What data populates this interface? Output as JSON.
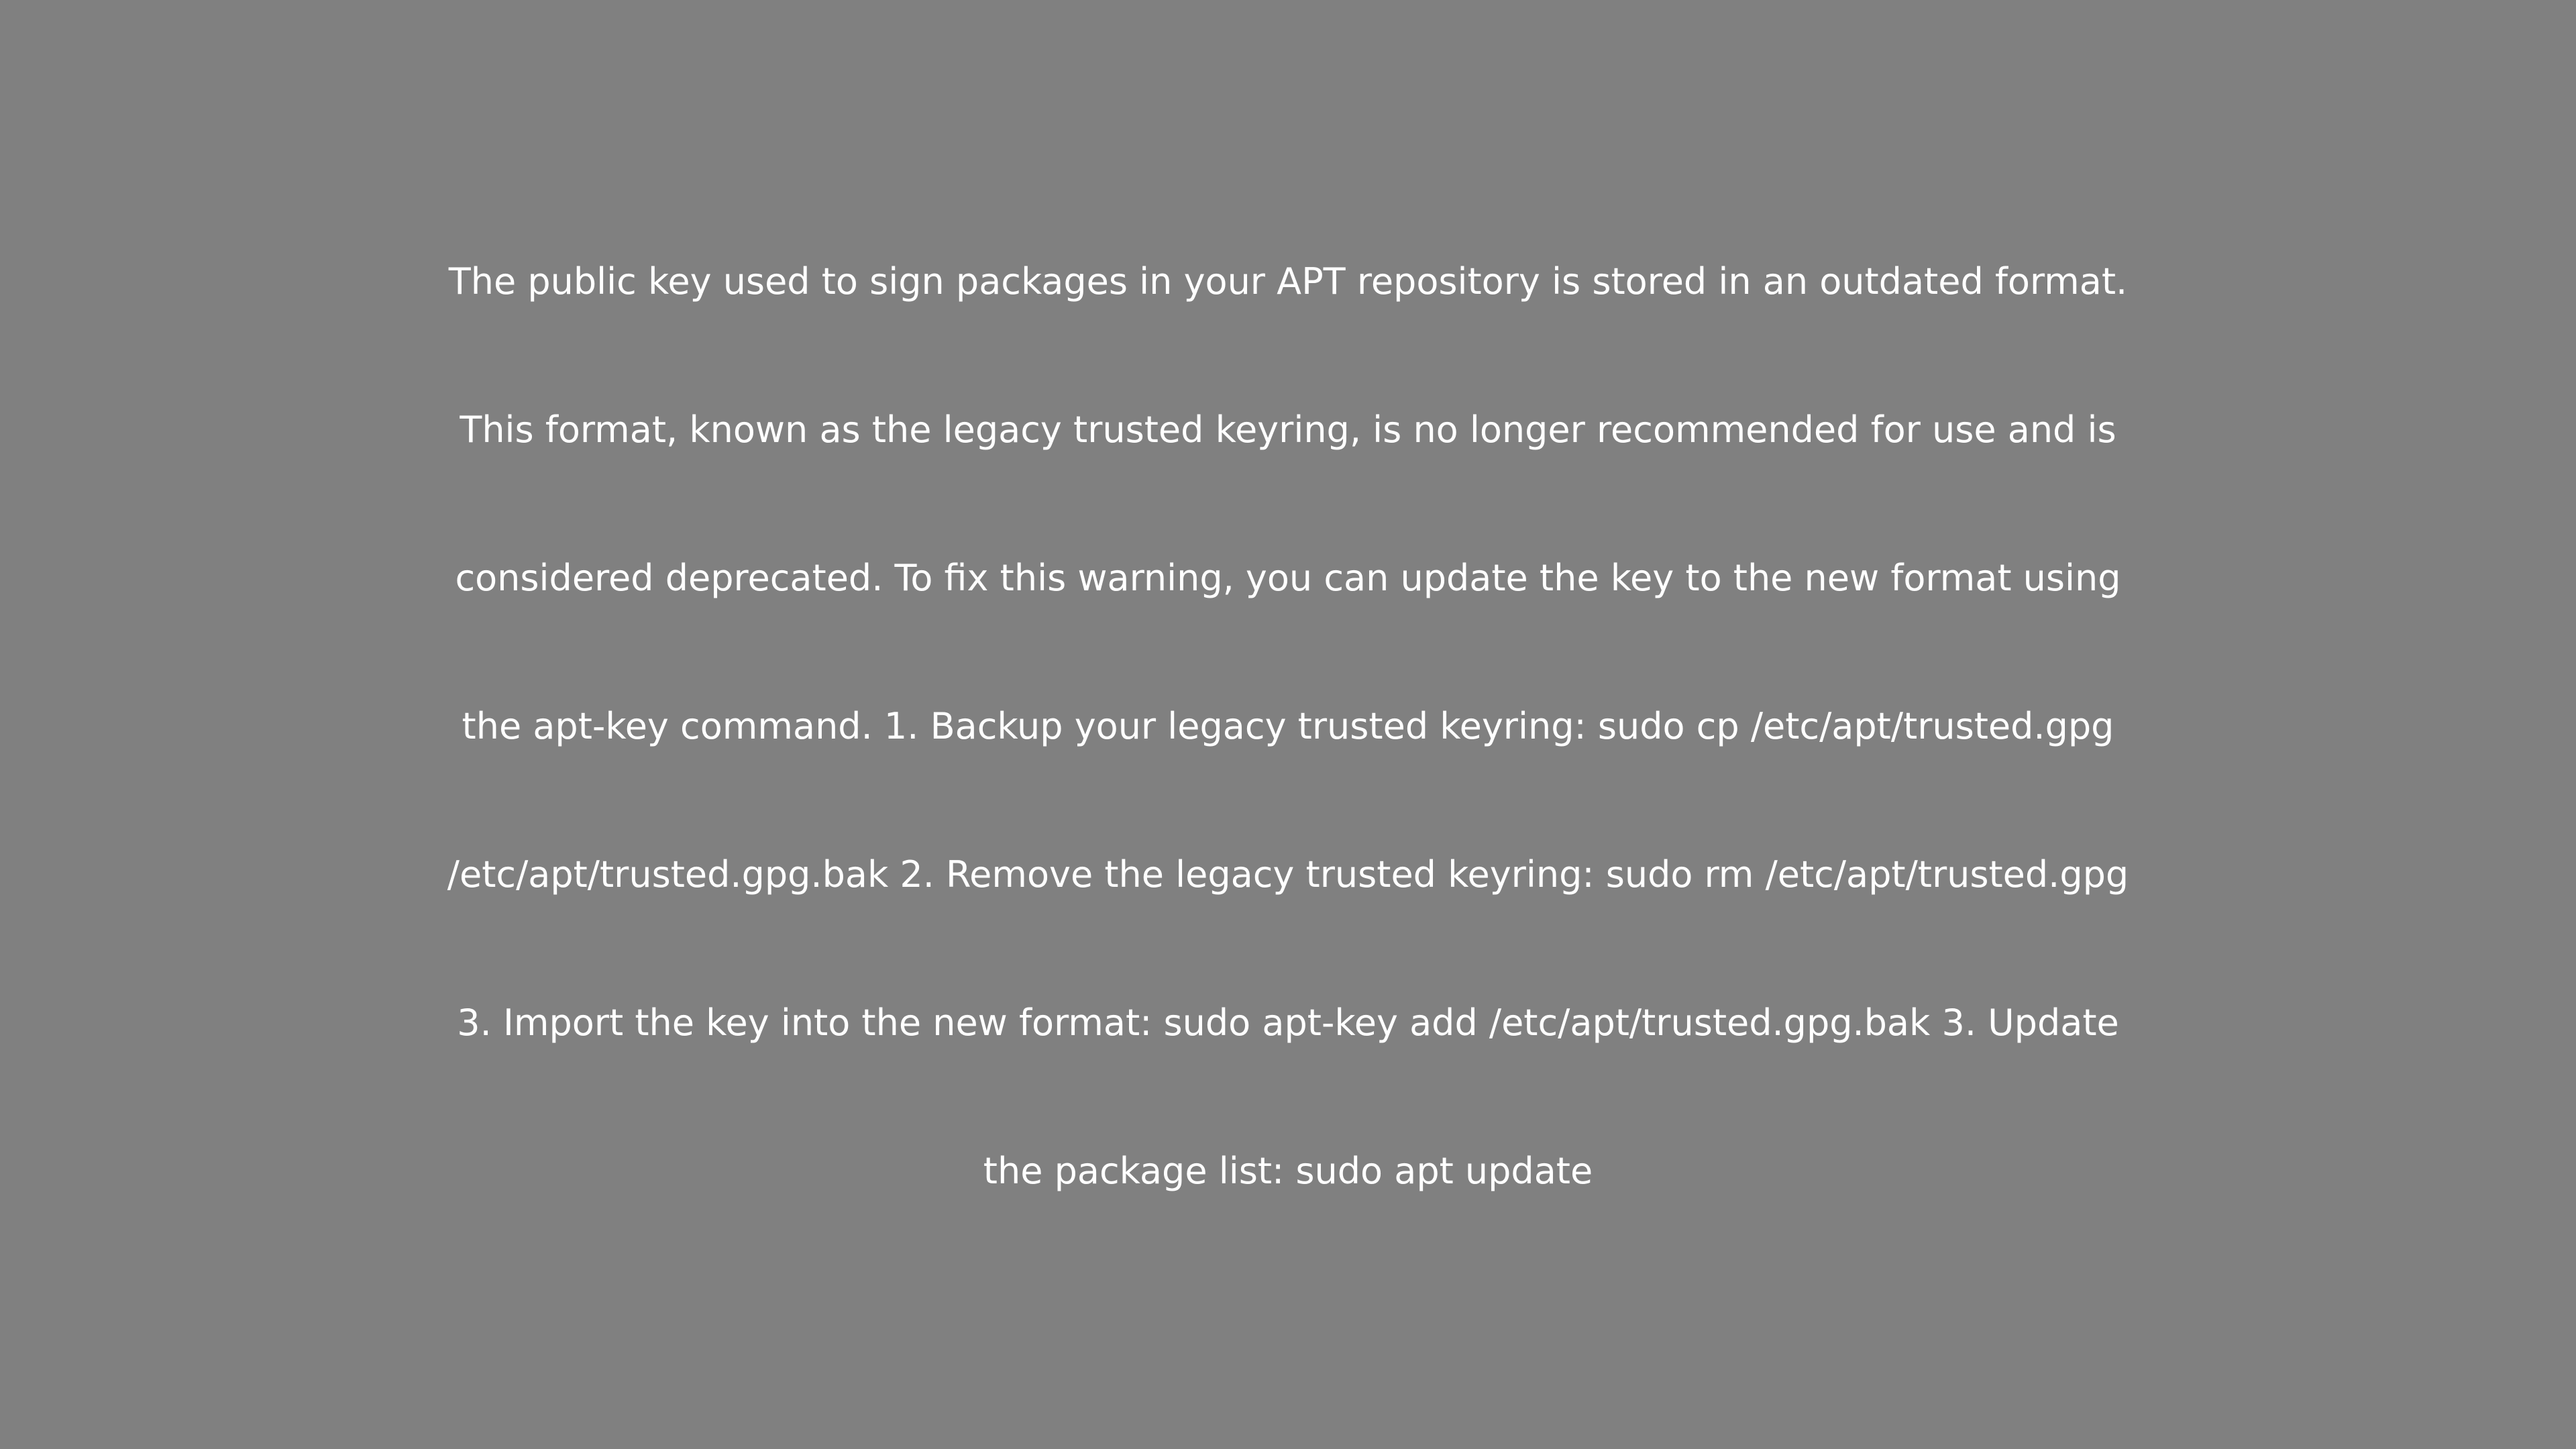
{
  "background_color": "#808080",
  "text_color": "#ffffff",
  "message": {
    "lines": [
      "The public key used to sign packages in your APT repository is stored in an outdated format.",
      "This format, known as the legacy trusted keyring, is no longer recommended for use and is",
      "considered deprecated. To fix this warning, you can update the key to the new format using",
      "the apt-key command. 1. Backup your legacy trusted keyring: sudo cp /etc/apt/trusted.gpg",
      "/etc/apt/trusted.gpg.bak 2. Remove the legacy trusted keyring: sudo rm /etc/apt/trusted.gpg",
      "3. Import the key into the new format: sudo apt-key add /etc/apt/trusted.gpg.bak 3. Update",
      "the package list: sudo apt update"
    ]
  }
}
